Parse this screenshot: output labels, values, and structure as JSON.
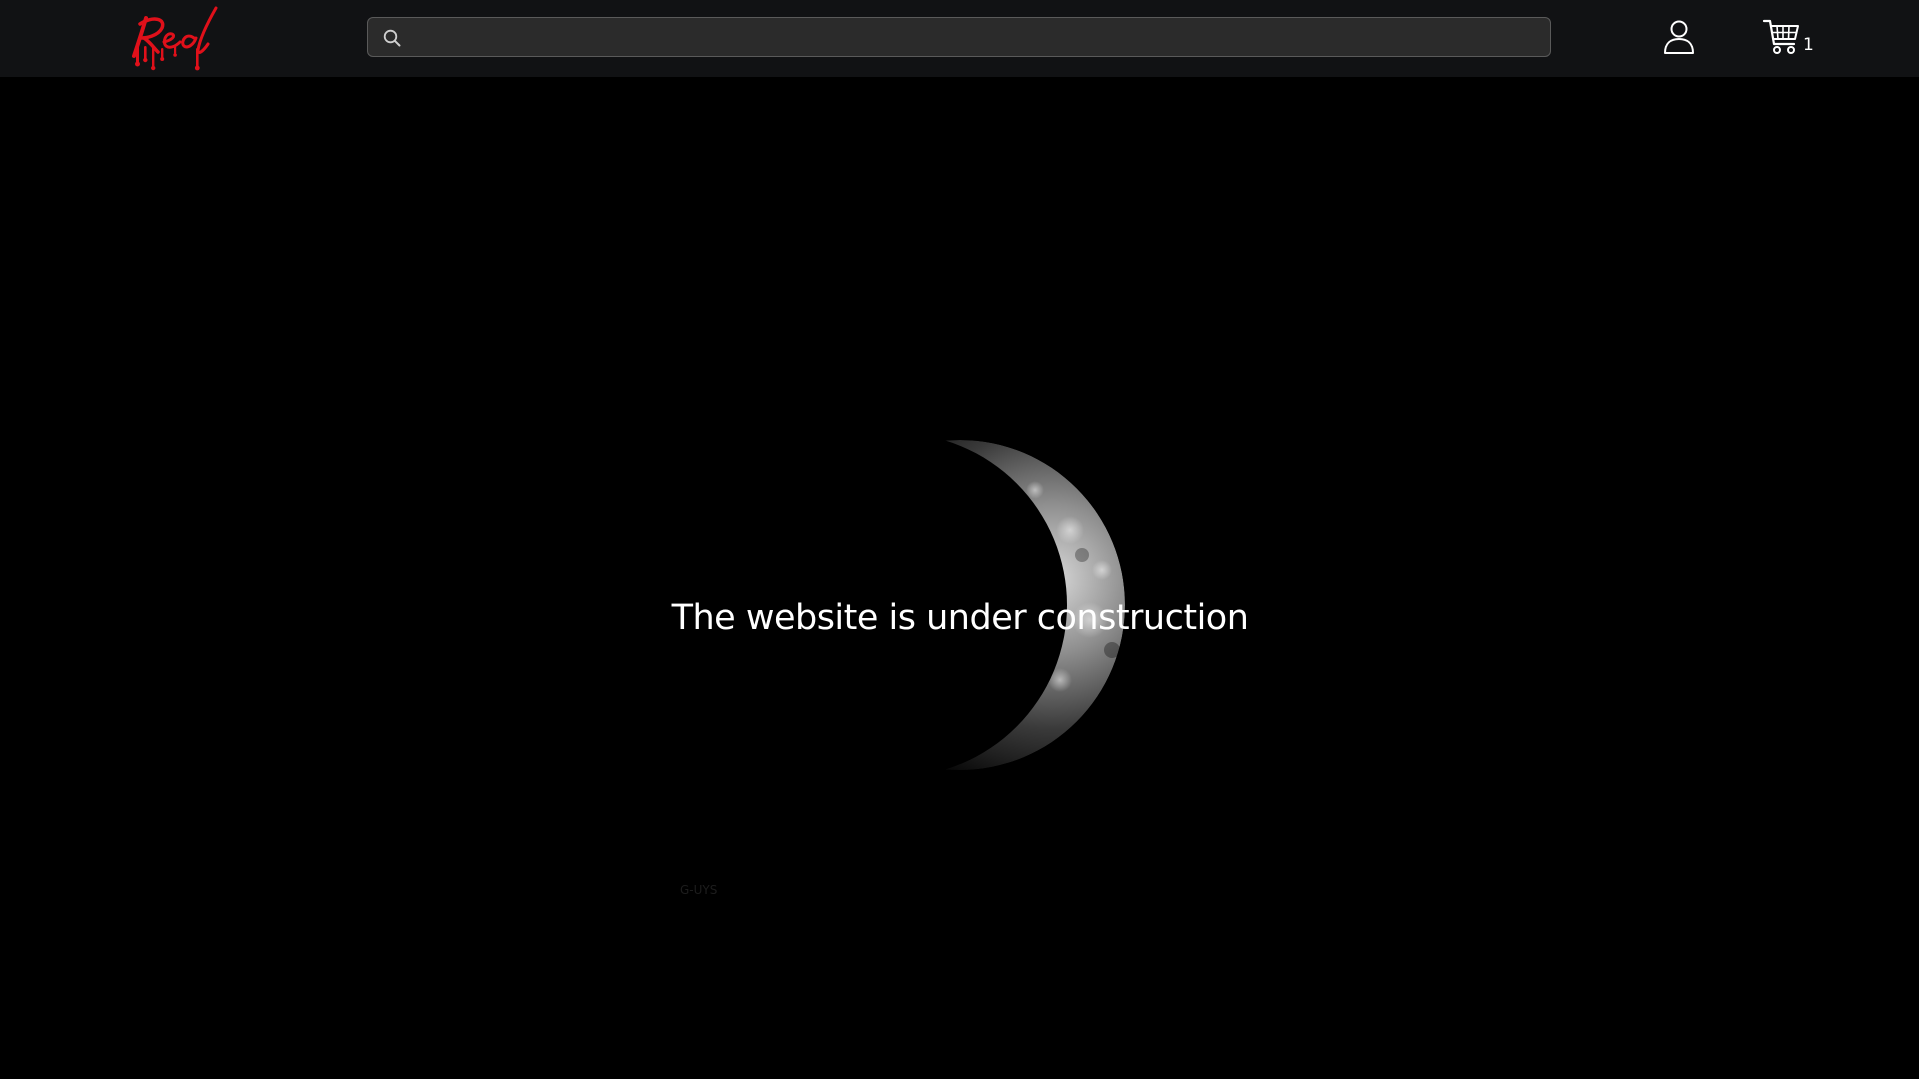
{
  "header": {
    "logo_text": "Red",
    "logo_icon": "red-dripping-script-logo",
    "search": {
      "icon": "search-icon",
      "placeholder": "",
      "value": ""
    },
    "account_icon": "user-icon",
    "cart": {
      "icon": "shopping-cart-icon",
      "count": "1"
    }
  },
  "main": {
    "headline": "The website is under construction",
    "background_image": "crescent-moon",
    "footer_mark": "G-UYS"
  },
  "colors": {
    "page_background": "#000000",
    "header_background": "#111214",
    "search_background": "#2b2b2b",
    "logo_red": "#e0101a",
    "text": "#ffffff"
  }
}
